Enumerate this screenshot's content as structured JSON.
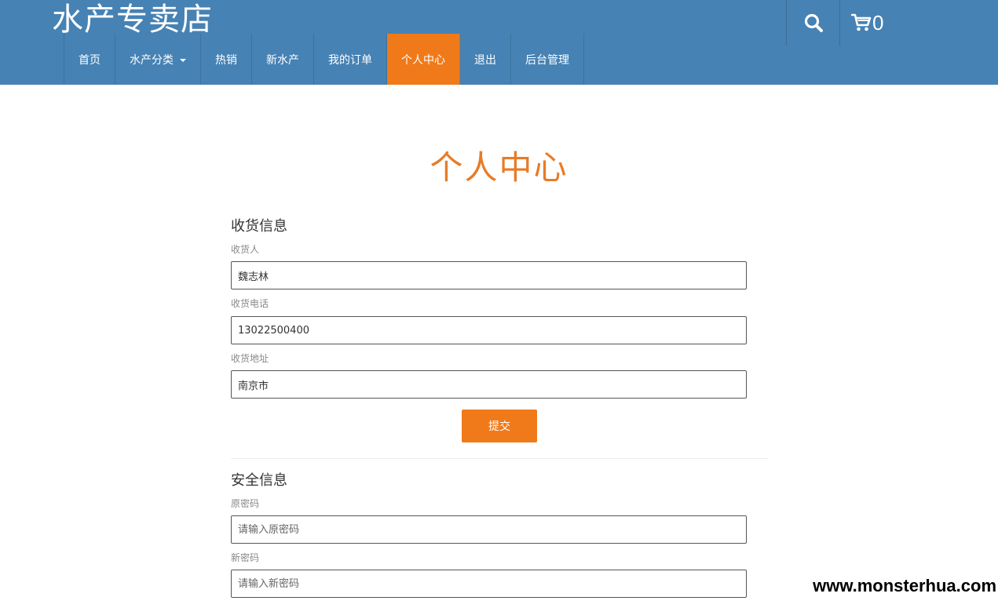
{
  "header": {
    "site_title": "水产专卖店",
    "cart_count": "0",
    "search_icon": "search-icon",
    "cart_icon": "cart-icon"
  },
  "nav": {
    "items": [
      {
        "label": "首页"
      },
      {
        "label": "水产分类"
      },
      {
        "label": "热销"
      },
      {
        "label": "新水产"
      },
      {
        "label": "我的订单"
      },
      {
        "label": "个人中心"
      },
      {
        "label": "退出"
      },
      {
        "label": "后台管理"
      }
    ],
    "active": "个人中心"
  },
  "page": {
    "title": "个人中心"
  },
  "shipping": {
    "section_title": "收货信息",
    "name_label": "收货人",
    "name_value": "魏志林",
    "phone_label": "收货电话",
    "phone_value": "13022500400",
    "address_label": "收货地址",
    "address_value": "南京市",
    "submit_label": "提交"
  },
  "security": {
    "section_title": "安全信息",
    "old_password_label": "原密码",
    "old_password_placeholder": "请输入原密码",
    "new_password_label": "新密码",
    "new_password_placeholder": "请输入新密码"
  },
  "watermark": "www.monsterhua.com",
  "colors": {
    "header_bg": "#4682b4",
    "accent": "#f07a1a",
    "title": "#e87b27"
  }
}
